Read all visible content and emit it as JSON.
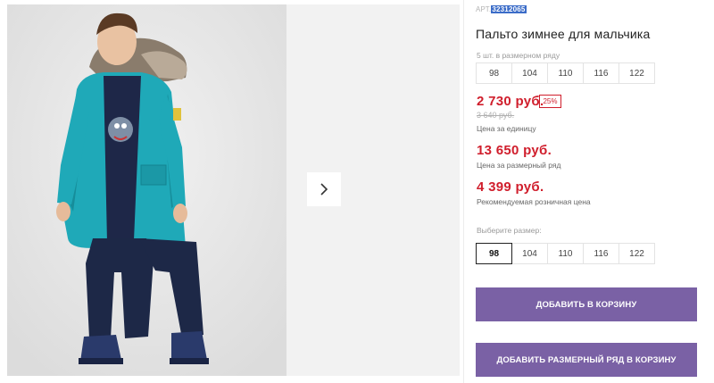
{
  "product": {
    "art_label": "АРТ.",
    "art_number": "32312065",
    "title": "Пальто зимнее для мальчика"
  },
  "size_row": {
    "caption": "5 шт. в размерном ряду",
    "sizes": [
      "98",
      "104",
      "110",
      "116",
      "122"
    ]
  },
  "pricing": {
    "unit_price": "2 730 руб.",
    "discount_badge": "25%",
    "old_price": "3 640 руб.",
    "unit_label": "Цена за единицу",
    "row_price": "13 650 руб.",
    "row_label": "Цена за размерный ряд",
    "retail_price": "4 399 руб.",
    "retail_label": "Рекомендуемая розничная цена"
  },
  "size_select": {
    "caption": "Выберите размер:",
    "sizes": [
      "98",
      "104",
      "110",
      "116",
      "122"
    ],
    "selected": "98"
  },
  "buttons": {
    "add_to_cart": "ДОБАВИТЬ В КОРЗИНУ",
    "add_row_to_cart": "ДОБАВИТЬ РАЗМЕРНЫЙ РЯД В КОРЗИНУ"
  },
  "colors": {
    "accent_purple": "#7a61a5",
    "price_red": "#d01e2c",
    "jacket_teal": "#1fa9b8",
    "pants_navy": "#1d2847"
  },
  "icons": {
    "next_arrow": "chevron-right-icon"
  }
}
